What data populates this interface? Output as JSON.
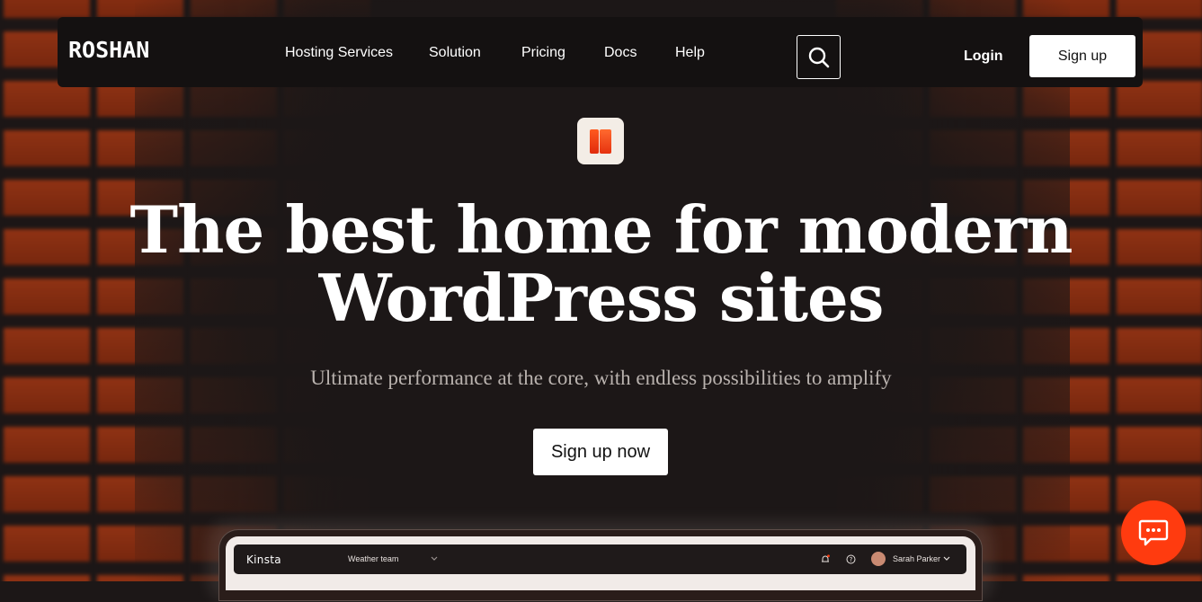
{
  "brand": {
    "logo": "ROSHAN"
  },
  "nav": {
    "links": [
      "Hosting Services",
      "Solution",
      "Pricing",
      "Docs",
      "Help"
    ],
    "login_label": "Login",
    "signup_label": "Sign up",
    "search_icon": "search-icon"
  },
  "hero": {
    "brand_mark_icon": "brand-mark-icon",
    "headline_line1": "The best home for modern",
    "headline_line2": "WordPress sites",
    "subtitle": "Ultimate performance at the core, with endless possibilities to amplify",
    "cta_label": "Sign up now"
  },
  "preview": {
    "logo": "Kinsta",
    "team": "Weather team",
    "user_name": "Sarah Parker",
    "icons": [
      "chevron-down-icon",
      "bell-icon",
      "help-icon",
      "avatar",
      "chevron-down-icon"
    ]
  },
  "chat": {
    "icon": "chat-icon"
  },
  "colors": {
    "accent": "#ff3b0f",
    "background": "#1c1717",
    "nav_background": "#141111",
    "button_background": "#ffffff"
  }
}
